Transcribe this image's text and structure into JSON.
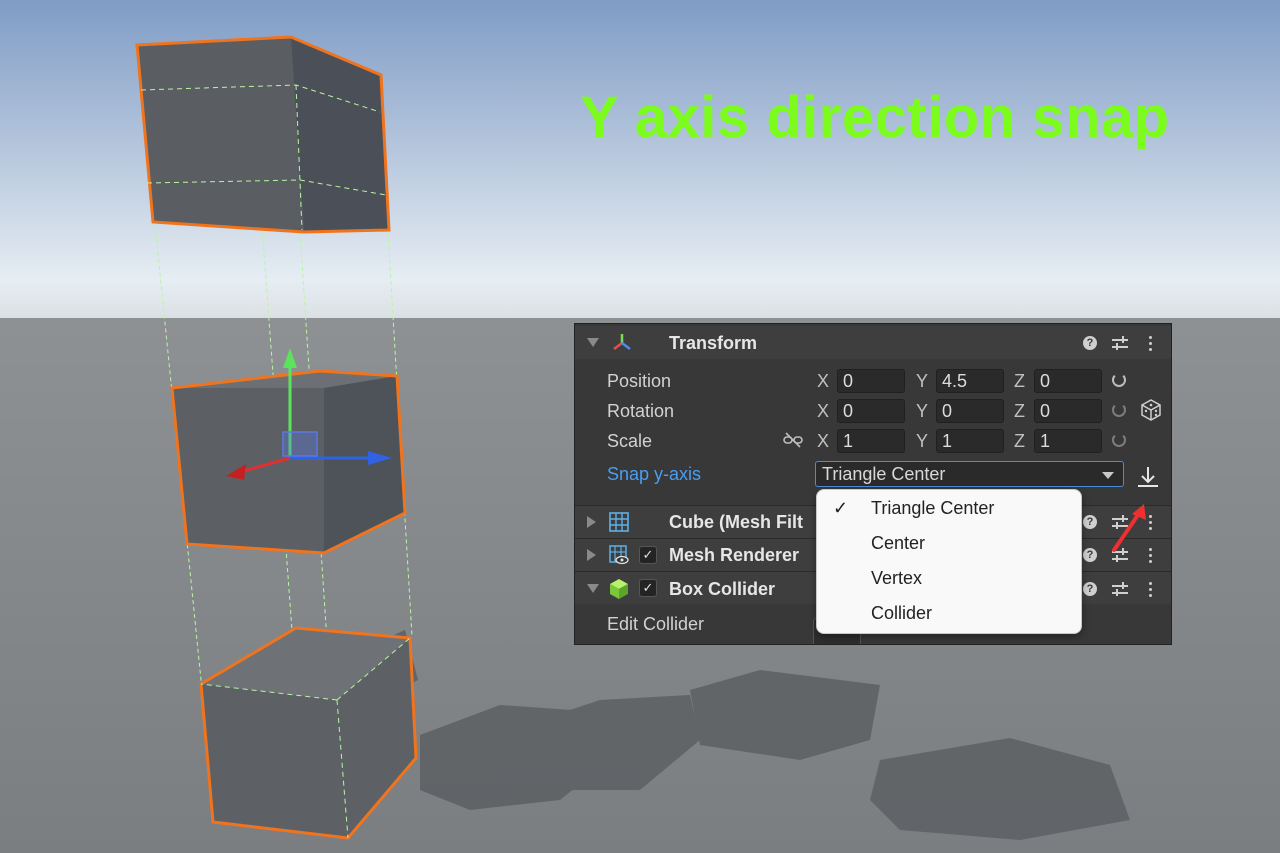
{
  "headline": "Y axis direction snap",
  "colors": {
    "headline": "#7CFC1C",
    "accent": "#4a9df2",
    "selection_outline": "#f0731e"
  },
  "inspector": {
    "transform": {
      "title": "Transform",
      "icon": "transform-axes-icon",
      "rows": [
        {
          "label": "Position",
          "x": "0",
          "y": "4.5",
          "z": "0"
        },
        {
          "label": "Rotation",
          "x": "0",
          "y": "0",
          "z": "0"
        },
        {
          "label": "Scale",
          "x": "1",
          "y": "1",
          "z": "1"
        }
      ],
      "axis_labels": {
        "x": "X",
        "y": "Y",
        "z": "Z"
      },
      "snap_label": "Snap y-axis",
      "snap_value": "Triangle Center"
    },
    "components": [
      {
        "title": "Cube (Mesh Filt",
        "icon": "mesh-grid-icon",
        "checkbox": false,
        "expanded": false
      },
      {
        "title": "Mesh Renderer",
        "icon": "mesh-renderer-icon",
        "checkbox": true,
        "expanded": false
      },
      {
        "title": "Box Collider",
        "icon": "box-collider-icon",
        "checkbox": true,
        "expanded": true
      }
    ],
    "edit_collider_label": "Edit Collider"
  },
  "snap_menu": {
    "selected": "Triangle Center",
    "options": [
      "Triangle Center",
      "Center",
      "Vertex",
      "Collider"
    ]
  }
}
